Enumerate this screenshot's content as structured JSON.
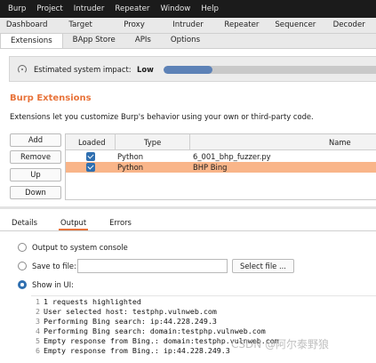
{
  "menu": [
    "Burp",
    "Project",
    "Intruder",
    "Repeater",
    "Window",
    "Help"
  ],
  "main_tabs": [
    "Dashboard",
    "Target",
    "Proxy",
    "Intruder",
    "Repeater",
    "Sequencer",
    "Decoder"
  ],
  "sub_tabs": [
    {
      "label": "Extensions",
      "active": true
    },
    {
      "label": "BApp Store",
      "active": false
    },
    {
      "label": "APIs",
      "active": false
    },
    {
      "label": "Options",
      "active": false
    }
  ],
  "impact": {
    "label": "Estimated system impact:",
    "value": "Low",
    "level": 0.22
  },
  "section": {
    "title": "Burp Extensions",
    "description": "Extensions let you customize Burp's behavior using your own or third-party code."
  },
  "buttons": {
    "add": "Add",
    "remove": "Remove",
    "up": "Up",
    "down": "Down"
  },
  "table": {
    "headers": {
      "loaded": "Loaded",
      "type": "Type",
      "name": "Name"
    },
    "rows": [
      {
        "loaded": true,
        "type": "Python",
        "name": "6_001_bhp_fuzzer.py",
        "selected": false
      },
      {
        "loaded": true,
        "type": "Python",
        "name": "BHP Bing",
        "selected": true
      }
    ]
  },
  "detail_tabs": [
    {
      "label": "Details",
      "active": false
    },
    {
      "label": "Output",
      "active": true
    },
    {
      "label": "Errors",
      "active": false
    }
  ],
  "output": {
    "system_console": "Output to system console",
    "save_to_file": "Save to file:",
    "select_file": "Select file ...",
    "show_in_ui": "Show in UI:",
    "file_value": ""
  },
  "console_lines": [
    {
      "n": "1",
      "text": "1 requests highlighted"
    },
    {
      "n": "2",
      "text": "User selected host: testphp.vulnweb.com"
    },
    {
      "n": "3",
      "text": "Performing Bing search: ip:44.228.249.3"
    },
    {
      "n": "4",
      "text": "Performing Bing search: domain:testphp.vulnweb.com"
    },
    {
      "n": "5",
      "text": "Empty response from Bing.: domain:testphp.vulnweb.com"
    },
    {
      "n": "6",
      "text": "Empty response from Bing.: ip:44.228.249.3"
    }
  ],
  "watermark": "CSDN @阿尔泰野狼",
  "colors": {
    "accent": "#e8733a",
    "selected_row": "#f9b589",
    "checkbox": "#2f6fb0",
    "impact_fill": "#5d82b7"
  }
}
